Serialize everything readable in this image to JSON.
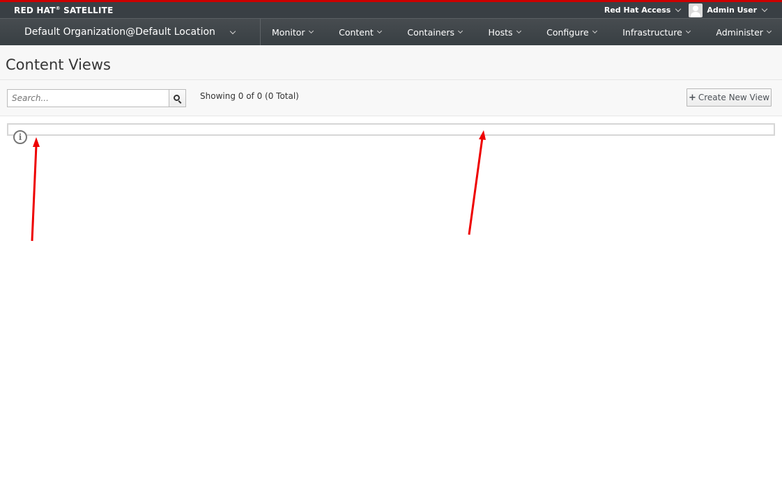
{
  "brand": {
    "name": "RED HAT",
    "sup": "®",
    "product": " SATELLITE"
  },
  "top_right": {
    "access_label": "Red Hat Access",
    "user_label": "Admin User"
  },
  "nav": {
    "org_label": "Default Organization@Default Location",
    "items": [
      "Monitor",
      "Content",
      "Containers",
      "Hosts",
      "Configure",
      "Infrastructure",
      "Administer"
    ]
  },
  "page": {
    "title": "Content Views"
  },
  "toolbar": {
    "search_placeholder": "Search...",
    "showing_text": "Showing 0 of 0 (0 Total)",
    "create_label": "Create New View",
    "create_icon": "plus-icon"
  },
  "annotation_colors": {
    "arrow": "#ee0000",
    "brand_accent": "#cc0000"
  }
}
